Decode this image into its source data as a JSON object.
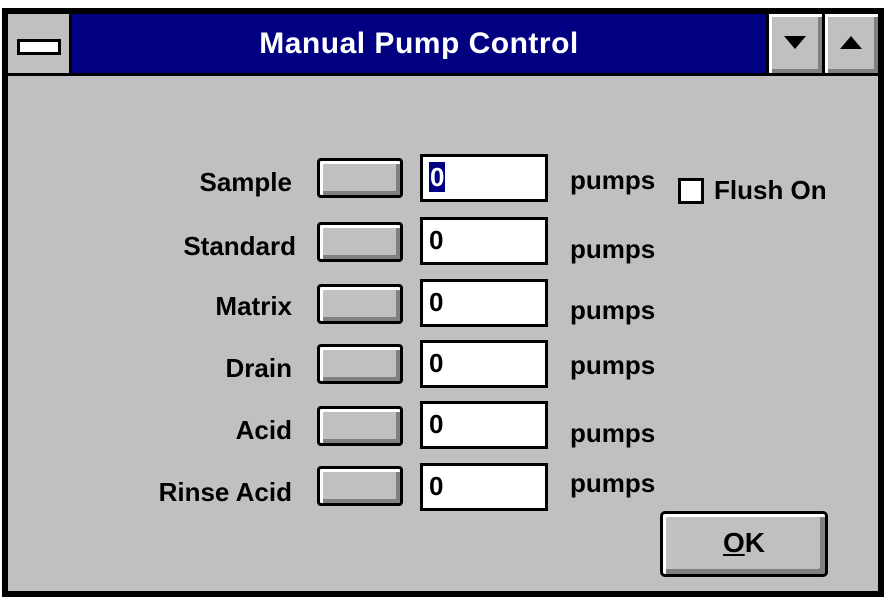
{
  "window": {
    "title": "Manual Pump Control"
  },
  "pumps": [
    {
      "label": "Sample",
      "count": "0",
      "unit": "pumps"
    },
    {
      "label": "Standard",
      "count": "0",
      "unit": "pumps"
    },
    {
      "label": "Matrix",
      "count": "0",
      "unit": "pumps"
    },
    {
      "label": "Drain",
      "count": "0",
      "unit": "pumps"
    },
    {
      "label": "Acid",
      "count": "0",
      "unit": "pumps"
    },
    {
      "label": "Rinse Acid",
      "count": "0",
      "unit": "pumps"
    }
  ],
  "flush": {
    "label": "Flush On",
    "checked": false
  },
  "buttons": {
    "ok_mnemonic": "O",
    "ok_rest": "K"
  },
  "colors": {
    "titlebar": "#000080",
    "face": "#c0c0c0"
  }
}
